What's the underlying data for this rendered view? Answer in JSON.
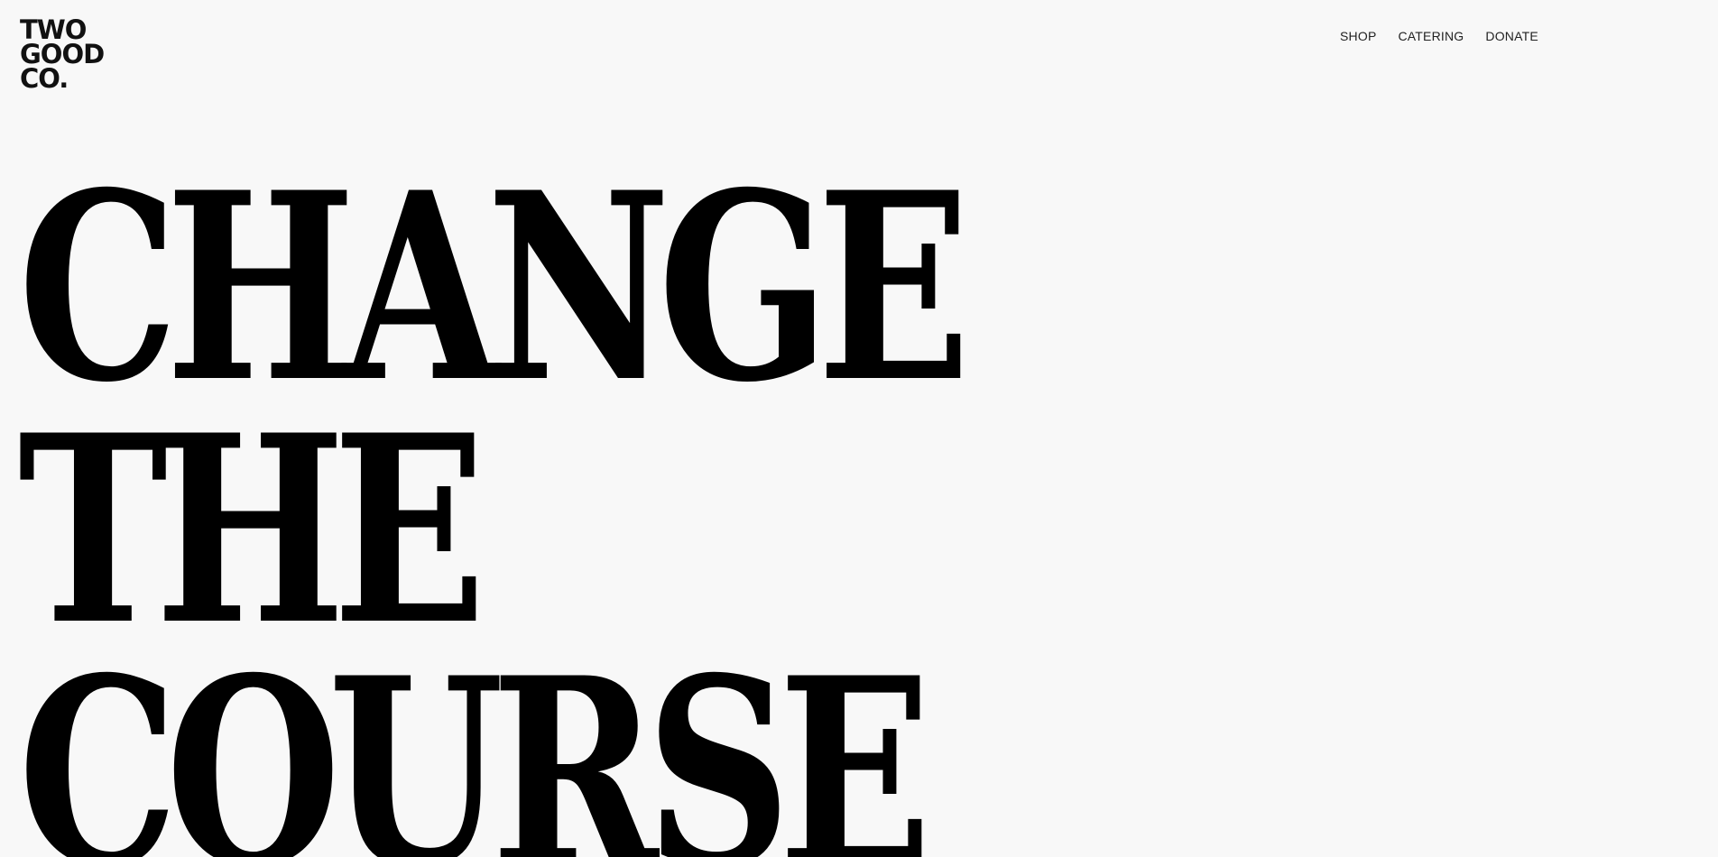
{
  "logo": {
    "line1": "TWO",
    "line2": "GOOD",
    "line3": "CO."
  },
  "nav": {
    "items": [
      {
        "label": "SHOP"
      },
      {
        "label": "CATERING"
      },
      {
        "label": "DONATE"
      }
    ]
  },
  "hero": {
    "line1": "CHANGE",
    "line2": "THE",
    "line3": "COURSE"
  }
}
